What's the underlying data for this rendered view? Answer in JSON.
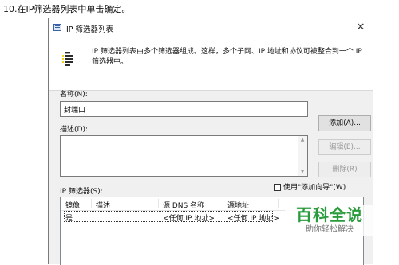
{
  "caption": "10.在IP筛选器列表中单击确定。",
  "dialog": {
    "title": "IP 筛选器列表",
    "close_symbol": "✕",
    "description": "IP 筛选器列表由多个筛选器组成。这样，多个子网、IP 地址和协议可被整合到一个 IP 筛选器中。",
    "name_label": "名称(N):",
    "name_value": "封端口",
    "description_label": "描述(D):",
    "description_value": "",
    "buttons": {
      "add": "添加(A)...",
      "edit": "编辑(E)...",
      "delete": "删除(R)"
    },
    "filters_label": "IP 筛选器(S):",
    "use_wizard_label": "使用\"添加向导\"(W)",
    "use_wizard_checked": false,
    "table": {
      "columns": [
        "镜像",
        "描述",
        "源 DNS 名称",
        "源地址"
      ],
      "rows": [
        [
          "是",
          "",
          "<任何 IP 地址>",
          "<任何 IP 地址>"
        ]
      ]
    }
  },
  "watermark": {
    "title": "百科全说",
    "subtitle": "助你轻松解决"
  },
  "colors": {
    "dialog_bg": "#f0f0f0",
    "watermark_green": "#2a9b3c",
    "icon_yellow": "#f2d21b"
  },
  "icons": {
    "title_icon": "filter-list-icon",
    "header_icon": "filter-list-icon",
    "close": "close-icon"
  }
}
